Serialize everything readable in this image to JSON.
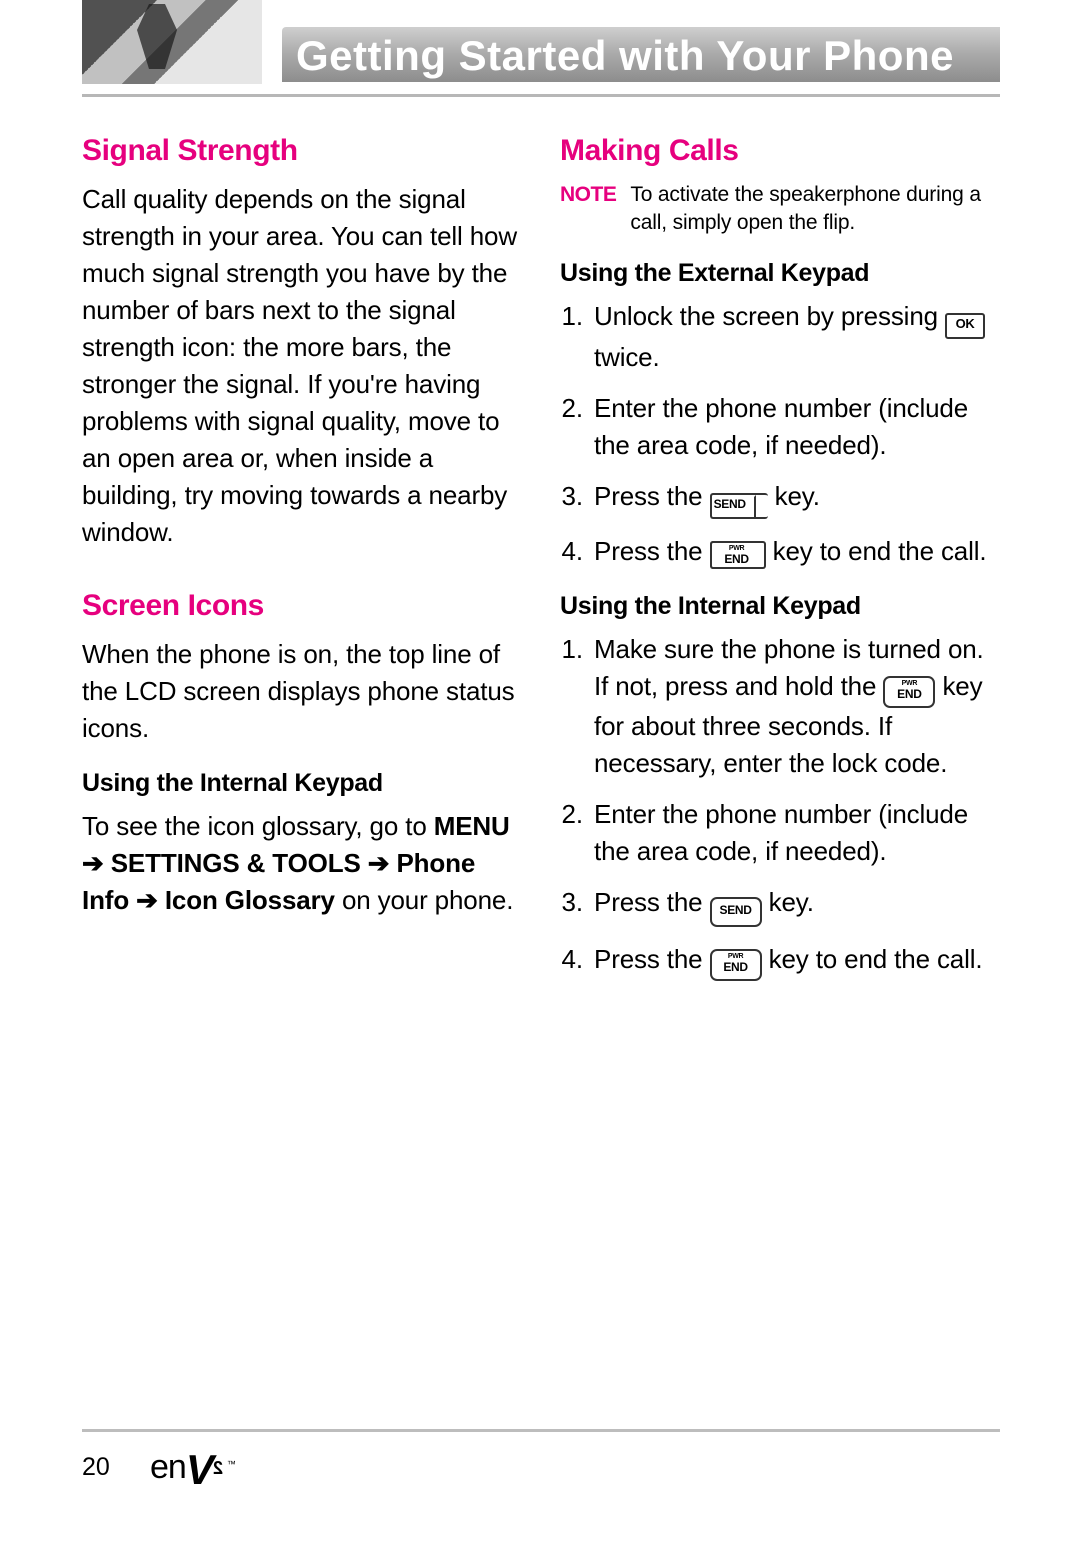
{
  "chapter_title": "Getting Started with Your Phone",
  "page_number": "20",
  "logo": {
    "en": "en",
    "v": "V",
    "two": "2",
    "tm": "™"
  },
  "left": {
    "signal_heading": "Signal Strength",
    "signal_body": "Call quality depends on the signal strength in your area. You can tell how much signal strength you have by the number of bars next to the signal strength icon: the more bars, the stronger the signal. If you're having problems with signal quality, move to an open area or, when inside a building, try moving towards a nearby window.",
    "icons_heading": "Screen Icons",
    "icons_body": "When the phone is on, the top line of the LCD screen displays phone status icons.",
    "internal_heading": "Using the Internal Keypad",
    "glossary_intro": "To see the icon glossary, go to ",
    "path1": "MENU",
    "path2": "SETTINGS & TOOLS",
    "path3": "Phone Info",
    "path4": "Icon Glossary",
    "glossary_tail": " on your phone."
  },
  "right": {
    "calls_heading": "Making Calls",
    "note_tag": "NOTE",
    "note_body": "To activate the speakerphone during a call, simply open the flip.",
    "ext_heading": "Using the External Keypad",
    "ext_steps": {
      "s1a": "Unlock the screen by pressing ",
      "s1b": " twice.",
      "s2": "Enter the phone number (include the area code, if needed).",
      "s3a": "Press the ",
      "s3b": " key.",
      "s4a": "Press the ",
      "s4b": " key to end the call."
    },
    "int_heading": "Using the Internal Keypad",
    "int_steps": {
      "s1a": "Make sure the phone is turned on. If not, press and hold the ",
      "s1b": " key for about three seconds. If necessary, enter the lock code.",
      "s2": "Enter the phone number (include the area code, if needed).",
      "s3a": "Press the ",
      "s3b": " key.",
      "s4a": "Press the ",
      "s4b": " key to end the call."
    }
  },
  "keys": {
    "ok": "OK",
    "send": "SEND",
    "pwr": "PWR",
    "end": "END"
  },
  "arrow": "➔"
}
